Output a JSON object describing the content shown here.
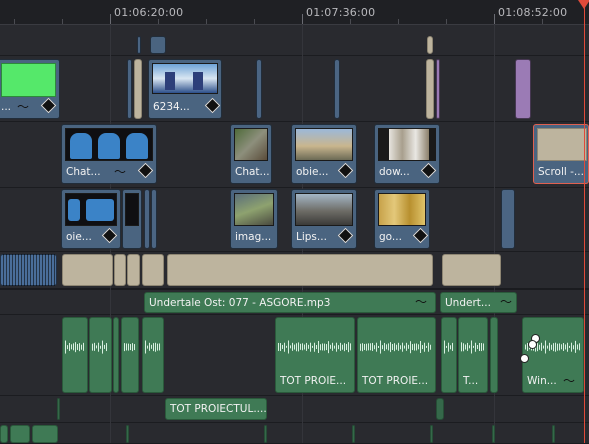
{
  "ruler": {
    "timecodes": [
      "01:06:20:00",
      "01:07:36:00",
      "01:08:52:00"
    ]
  },
  "video_tracks": {
    "v4_clips": [
      {
        "name": "...",
        "label": "..."
      },
      {
        "name": "6234...",
        "label": "6234..."
      }
    ],
    "v3_clips": [
      {
        "label": "Chat..."
      },
      {
        "label": "Chat..."
      },
      {
        "label": "obie..."
      },
      {
        "label": "dow..."
      },
      {
        "label": "Scroll -..."
      }
    ],
    "v2_clips": [
      {
        "label": "oie..."
      },
      {
        "label": "imag..."
      },
      {
        "label": "Lips..."
      },
      {
        "label": "go..."
      }
    ]
  },
  "audio_tracks": {
    "music_clips": [
      {
        "label": "Undertale Ost: 077 - ASGORE.mp3"
      },
      {
        "label": "Undert..."
      }
    ],
    "voice_clips": [
      {
        "label": "TOT PROIE..."
      },
      {
        "label": "TOT PROIE..."
      },
      {
        "label": "T..."
      },
      {
        "label": "Win..."
      }
    ],
    "lower_clips": [
      {
        "label": "TOT PROIECTUL...."
      }
    ]
  },
  "colors": {
    "background": "#2a2b30",
    "video_clip": "#4a6480",
    "audio_clip": "#3f7a55",
    "placeholder_clip": "#bdb49e",
    "generator_clip": "#55e86a",
    "adjustment_clip": "#9b7bb5",
    "playhead": "#e04a3a"
  },
  "icons": [
    "diamond-fx-icon",
    "curve-keyframe-icon"
  ]
}
